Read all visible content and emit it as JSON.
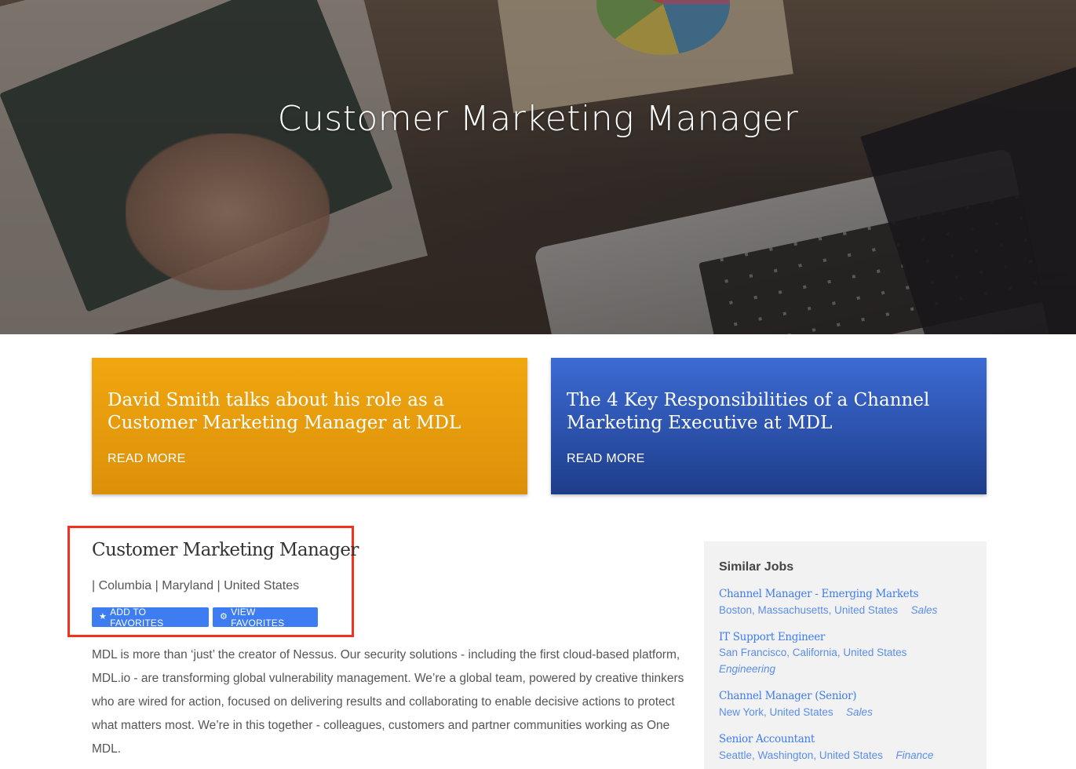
{
  "hero": {
    "title": "Customer Marketing Manager"
  },
  "promo_cards": [
    {
      "title": "David Smith talks about his role as a Customer Marketing Manager at MDL",
      "link": "READ MORE",
      "color": "#e89c0d"
    },
    {
      "title": "The 4 Key Responsibilities of a Channel Marketing Executive at MDL",
      "link": "READ MORE",
      "color": "#2c53b0"
    }
  ],
  "job": {
    "title": "Customer Marketing Manager",
    "location": "| Columbia | Maryland | United States",
    "add_favorites": "ADD TO FAVORITES",
    "view_favorites": "VIEW FAVORITES",
    "description": "MDL is more than ‘just’ the creator of Nessus. Our security solutions - including the first cloud-based platform, MDL.io - are transforming global vulnerability management. We’re a global team, powered by creative thinkers who are wired for action, focused on delivering results and collaborating to enable decisive actions to protect what matters most. We’re in this together - colleagues, customers and partner communities working as One MDL."
  },
  "sidebar": {
    "heading": "Similar Jobs",
    "jobs": [
      {
        "title": "Channel Manager - Emerging Markets",
        "location": "Boston, Massachusetts, United States",
        "category": "Sales"
      },
      {
        "title": "IT Support Engineer",
        "location": "San Francisco, California, United States",
        "category": "Engineering"
      },
      {
        "title": "Channel Manager (Senior)",
        "location": "New York, United States",
        "category": "Sales"
      },
      {
        "title": "Senior Accountant",
        "location": "Seattle, Washington, United States",
        "category": "Finance"
      }
    ]
  },
  "colors": {
    "accent_button": "#3e7cf2",
    "highlight_border": "#f2311f",
    "link": "#3e7cf2"
  }
}
